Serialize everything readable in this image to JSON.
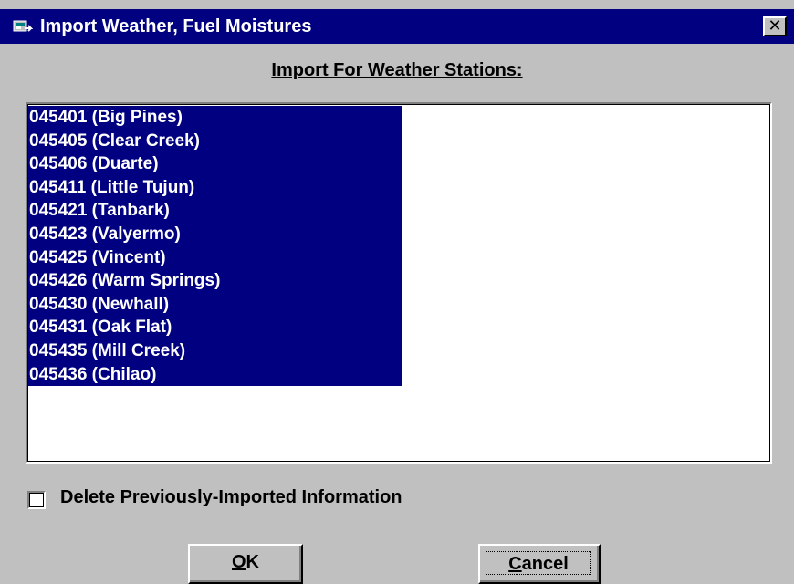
{
  "window": {
    "title": "Import Weather, Fuel Moistures",
    "close_glyph": "✕",
    "icon": "app-import-icon",
    "title_bar_color": "#000080",
    "face_color": "#c0c0c0"
  },
  "heading": "Import For Weather Stations:",
  "stations": {
    "selection_color": "#000080",
    "items": [
      "045401 (Big Pines)",
      "045405 (Clear Creek)",
      "045406 (Duarte)",
      "045411 (Little Tujun)",
      "045421 (Tanbark)",
      "045423 (Valyermo)",
      "045425 (Vincent)",
      "045426 (Warm Springs)",
      "045430 (Newhall)",
      "045431 (Oak Flat)",
      "045435 (Mill Creek)",
      "045436 (Chilao)"
    ]
  },
  "delete_option": {
    "label": "Delete Previously-Imported Information",
    "checked": false
  },
  "buttons": {
    "ok": {
      "accel": "O",
      "rest": "K"
    },
    "cancel": {
      "accel": "C",
      "rest": "ancel"
    }
  }
}
